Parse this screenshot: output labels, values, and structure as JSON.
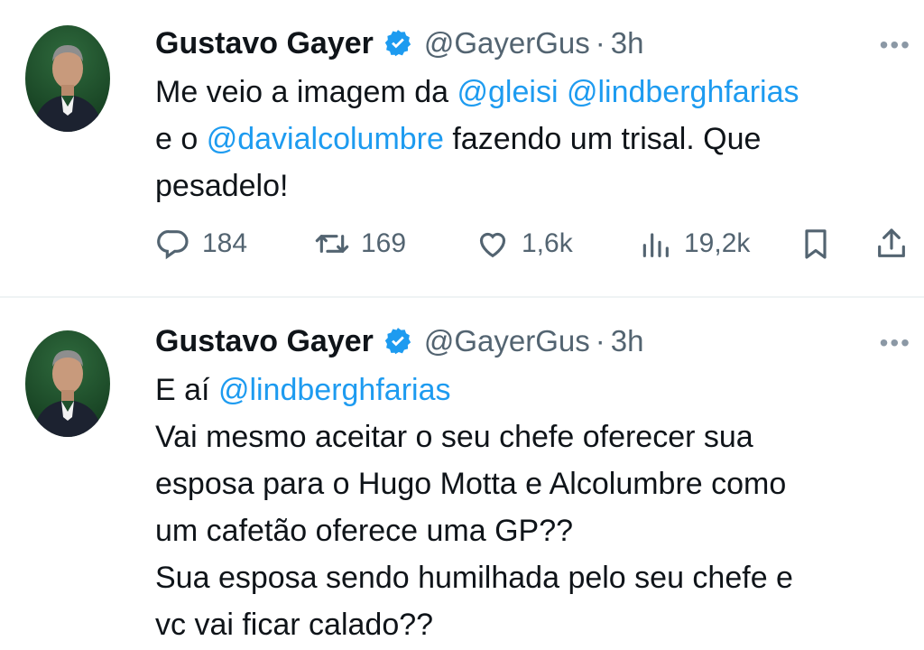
{
  "tweets": [
    {
      "author": {
        "name": "Gustavo Gayer",
        "handle": "@GayerGus",
        "separator": "·",
        "time": "3h"
      },
      "more_label": "•••",
      "text_lines": [
        [
          {
            "t": "Me veio a imagem da ",
            "m": false
          },
          {
            "t": "@gleisi",
            "m": true
          },
          {
            "t": " ",
            "m": false
          },
          {
            "t": "@lindberghfarias",
            "m": true
          }
        ],
        [
          {
            "t": "e o ",
            "m": false
          },
          {
            "t": "@davialcolumbre",
            "m": true
          },
          {
            "t": " fazendo um trisal. Que",
            "m": false
          }
        ],
        [
          {
            "t": "pesadelo!",
            "m": false
          }
        ]
      ],
      "actions": {
        "replies": "184",
        "retweets": "169",
        "likes": "1,6k",
        "views": "19,2k"
      }
    },
    {
      "author": {
        "name": "Gustavo Gayer",
        "handle": "@GayerGus",
        "separator": "·",
        "time": "3h"
      },
      "more_label": "•••",
      "text_lines": [
        [
          {
            "t": "E aí ",
            "m": false
          },
          {
            "t": "@lindberghfarias",
            "m": true
          }
        ],
        [
          {
            "t": "Vai mesmo aceitar o seu chefe oferecer sua",
            "m": false
          }
        ],
        [
          {
            "t": "esposa para o Hugo Motta e Alcolumbre como",
            "m": false
          }
        ],
        [
          {
            "t": "um cafetão oferece uma GP??",
            "m": false
          }
        ],
        [
          {
            "t": "Sua esposa sendo humilhada pelo seu chefe e",
            "m": false
          }
        ],
        [
          {
            "t": "vc vai ficar calado??",
            "m": false
          }
        ]
      ]
    }
  ],
  "colors": {
    "mention": "#1d9bf0",
    "secondary": "#536471",
    "verified": "#1d9bf0",
    "divider": "#eff3f4"
  },
  "icons": [
    "verified-badge-icon",
    "more-icon",
    "reply-icon",
    "retweet-icon",
    "like-icon",
    "views-icon",
    "bookmark-icon",
    "share-icon"
  ]
}
